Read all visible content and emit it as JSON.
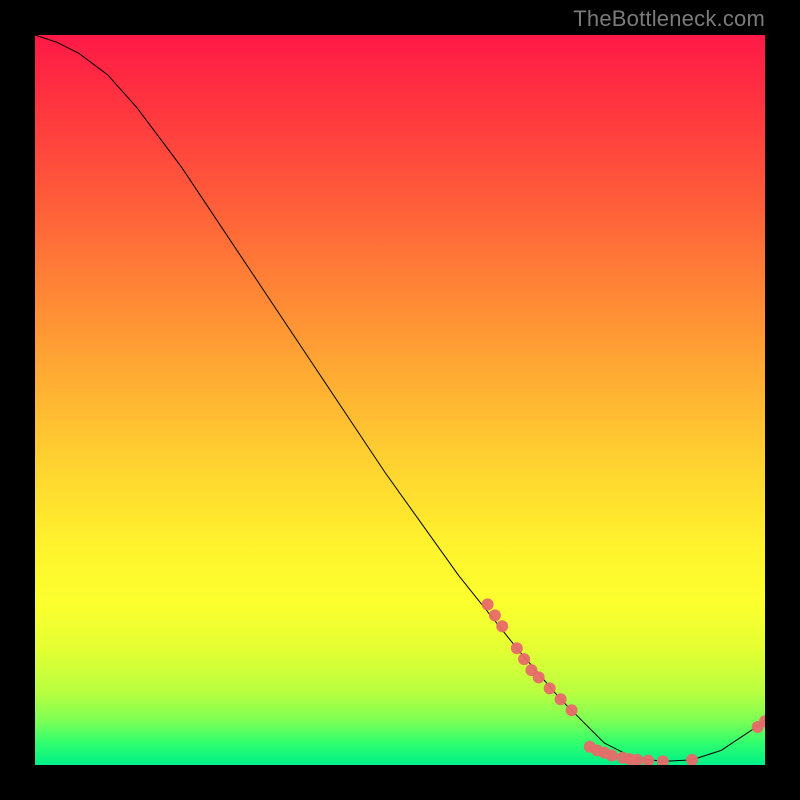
{
  "watermark": "TheBottleneck.com",
  "chart_data": {
    "type": "line",
    "title": "",
    "xlabel": "",
    "ylabel": "",
    "xlim": [
      0,
      100
    ],
    "ylim": [
      0,
      100
    ],
    "grid": false,
    "legend": false,
    "curve_points": [
      {
        "x": 0,
        "y": 100
      },
      {
        "x": 3,
        "y": 99
      },
      {
        "x": 6,
        "y": 97.5
      },
      {
        "x": 10,
        "y": 94.5
      },
      {
        "x": 14,
        "y": 90
      },
      {
        "x": 20,
        "y": 82
      },
      {
        "x": 28,
        "y": 70
      },
      {
        "x": 38,
        "y": 55
      },
      {
        "x": 48,
        "y": 40
      },
      {
        "x": 58,
        "y": 26
      },
      {
        "x": 66,
        "y": 16
      },
      {
        "x": 72,
        "y": 9
      },
      {
        "x": 78,
        "y": 3
      },
      {
        "x": 82,
        "y": 1
      },
      {
        "x": 86,
        "y": 0.5
      },
      {
        "x": 90,
        "y": 0.7
      },
      {
        "x": 94,
        "y": 2
      },
      {
        "x": 97,
        "y": 4
      },
      {
        "x": 100,
        "y": 6
      }
    ],
    "dot_points": [
      {
        "x": 62,
        "y": 22
      },
      {
        "x": 63,
        "y": 20.5
      },
      {
        "x": 64,
        "y": 19
      },
      {
        "x": 66,
        "y": 16
      },
      {
        "x": 67,
        "y": 14.5
      },
      {
        "x": 68,
        "y": 13
      },
      {
        "x": 69,
        "y": 12
      },
      {
        "x": 70.5,
        "y": 10.5
      },
      {
        "x": 72,
        "y": 9
      },
      {
        "x": 73.5,
        "y": 7.5
      },
      {
        "x": 76,
        "y": 2.5
      },
      {
        "x": 77,
        "y": 2
      },
      {
        "x": 78,
        "y": 1.7
      },
      {
        "x": 79,
        "y": 1.3
      },
      {
        "x": 80.5,
        "y": 1
      },
      {
        "x": 81.5,
        "y": 0.8
      },
      {
        "x": 82.5,
        "y": 0.7
      },
      {
        "x": 84,
        "y": 0.6
      },
      {
        "x": 86,
        "y": 0.5
      },
      {
        "x": 90,
        "y": 0.7
      },
      {
        "x": 99,
        "y": 5.2
      },
      {
        "x": 100,
        "y": 6
      }
    ],
    "line_color": "#000000",
    "dot_color": "#e86a6a",
    "dot_radius_px": 6
  }
}
